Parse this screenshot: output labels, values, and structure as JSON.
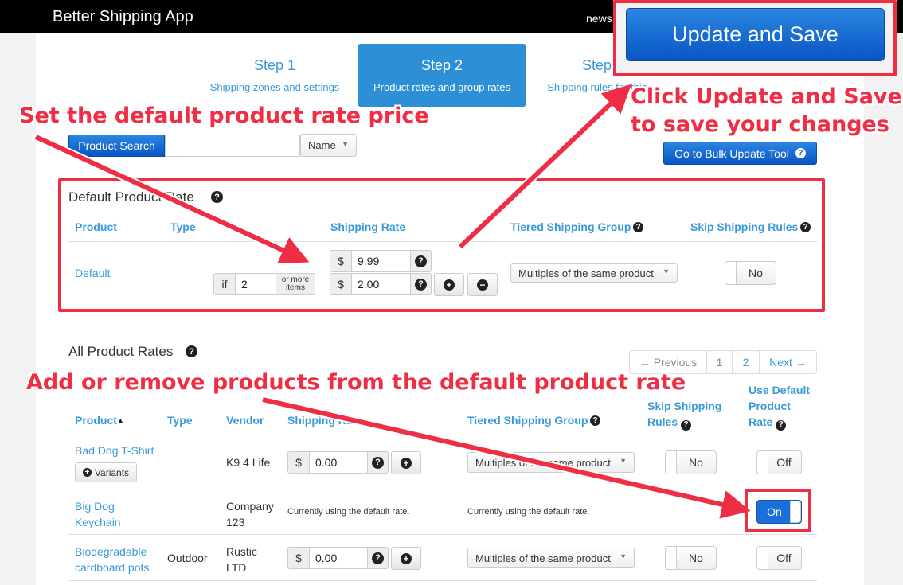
{
  "app": {
    "title": "Better Shipping App",
    "news_label": "news"
  },
  "steps": [
    {
      "title": "Step 1",
      "subtitle": "Shipping zones and settings"
    },
    {
      "title": "Step 2",
      "subtitle": "Product rates and group rates"
    },
    {
      "title": "Step 3",
      "subtitle": "Shipping rules for this ..."
    }
  ],
  "header_actions": {
    "update_save_label": "Update and Save",
    "bulk_tool_label": "Go to Bulk Update Tool"
  },
  "search": {
    "button_label": "Product Search",
    "value": "",
    "field_selected": "Name"
  },
  "default_rate": {
    "title": "Default Product Rate",
    "columns": [
      "Product",
      "Type",
      "Shipping Rate",
      "Tiered Shipping Group",
      "Skip Shipping Rules"
    ],
    "product": "Default",
    "currency": "$",
    "rate": "9.99",
    "tier_if": "if",
    "tier_qty": "2",
    "tier_more_label": "or more items",
    "tier_rate": "2.00",
    "tiered_group": "Multiples of the same product",
    "skip_rules": "No"
  },
  "all_rates": {
    "title": "All Product Rates",
    "pagination": {
      "prev": "← Previous",
      "pages": [
        "1",
        "2"
      ],
      "next": "Next →"
    },
    "columns": {
      "product": "Product",
      "type": "Type",
      "vendor": "Vendor",
      "shipping_rate": "Shipping Rate",
      "tiered_group": "Tiered Shipping Group",
      "skip_rules": "Skip Shipping Rules",
      "use_default": "Use Default Product Rate"
    },
    "rows": [
      {
        "product": "Bad Dog T-Shirt",
        "variants_label": "Variants",
        "type": "",
        "vendor": "K9 4 Life",
        "currency": "$",
        "rate": "0.00",
        "tiered_group": "Multiples of the same product",
        "skip_rules": "No",
        "use_default": "Off"
      },
      {
        "product": "Big Dog Keychain",
        "type": "",
        "vendor": "Company 123",
        "rate_note": "Currently using the default rate.",
        "group_note": "Currently using the default rate.",
        "use_default": "On"
      },
      {
        "product": "Biodegradable cardboard pots",
        "type": "Outdoor",
        "vendor": "Rustic LTD",
        "currency": "$",
        "rate": "0.00",
        "tiered_group": "Multiples of the same product",
        "skip_rules": "No",
        "use_default": "Off"
      }
    ]
  },
  "annotations": {
    "set_default": "Set the default product rate price",
    "click_update_line1": "Click Update and Save",
    "click_update_line2": "to save your changes",
    "add_remove": "Add or remove products from the default product rate"
  },
  "colors": {
    "annotation_red": "#ef2d44",
    "link_blue": "#3a9ad9",
    "primary_blue": "#0a55c4"
  }
}
